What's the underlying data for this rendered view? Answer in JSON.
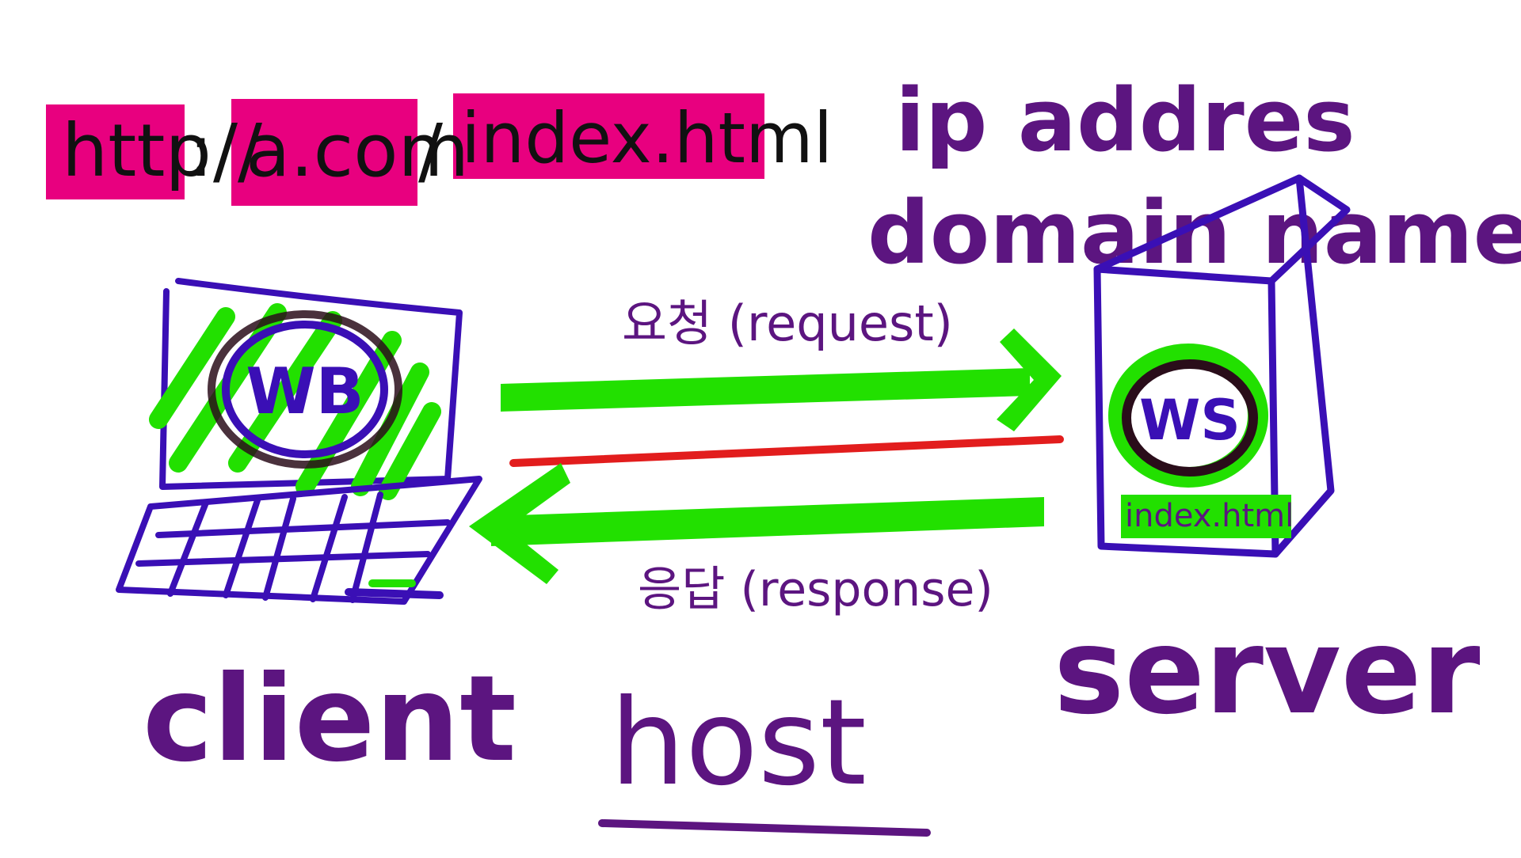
{
  "url": {
    "scheme": "http",
    "separator": "://",
    "domain": "a.com",
    "slash": "/",
    "path": "index.html"
  },
  "server_note": {
    "line1": "ip addres",
    "line2": "domain name"
  },
  "request_label": "요청 (request)",
  "response_label": "응답 (response)",
  "client": {
    "badge": "WB",
    "label": "client"
  },
  "server": {
    "badge": "WS",
    "file_label": "index.html",
    "label": "server"
  },
  "host_label": "host",
  "colors": {
    "highlight_pink": "#e8007f",
    "ink_black": "#111111",
    "ink_purple": "#5c1580",
    "stroke_blue": "#3a0fb5",
    "marker_green": "#22e000",
    "line_red": "#e21d1d"
  }
}
